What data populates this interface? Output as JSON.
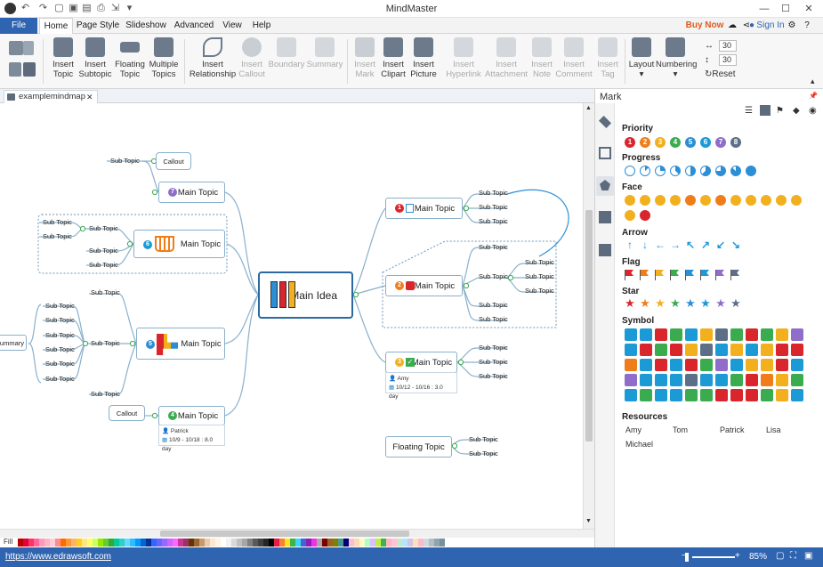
{
  "app": {
    "title": "MindMaster",
    "buy": "Buy Now",
    "signin": "Sign In"
  },
  "menu": {
    "file": "File",
    "home": "Home",
    "page_style": "Page Style",
    "slideshow": "Slideshow",
    "advanced": "Advanced",
    "view": "View",
    "help": "Help"
  },
  "ribbon": {
    "insert_topic": [
      "Insert",
      "Topic"
    ],
    "insert_subtopic": [
      "Insert",
      "Subtopic"
    ],
    "floating_topic": [
      "Floating",
      "Topic"
    ],
    "multiple_topics": [
      "Multiple",
      "Topics"
    ],
    "insert_relationship": [
      "Insert",
      "Relationship"
    ],
    "insert_callout": [
      "Insert",
      "Callout"
    ],
    "boundary": "Boundary",
    "summary": "Summary",
    "insert_mark": [
      "Insert",
      "Mark"
    ],
    "insert_clipart": [
      "Insert",
      "Clipart"
    ],
    "insert_picture": [
      "Insert",
      "Picture"
    ],
    "insert_hyperlink": [
      "Insert",
      "Hyperlink"
    ],
    "insert_attachment": [
      "Insert",
      "Attachment"
    ],
    "insert_note": [
      "Insert",
      "Note"
    ],
    "insert_comment": [
      "Insert",
      "Comment"
    ],
    "insert_tag": [
      "Insert",
      "Tag"
    ],
    "layout": "Layout",
    "numbering": "Numbering",
    "spacing_h": "30",
    "spacing_v": "30",
    "reset": "Reset"
  },
  "doc_tab": "examplemindmap",
  "map": {
    "main_idea": "Main Idea",
    "main_topic": "Main Topic",
    "sub_topic": "Sub Topic",
    "callout": "Callout",
    "summary": "Summary",
    "floating_topic": "Floating Topic",
    "amy": "Amy",
    "amy_date": "10/12 - 10/16 : 3.0 day",
    "patrick": "Patrick",
    "patrick_date": "10/9 - 10/18 : 8.0 day"
  },
  "panel": {
    "title": "Mark",
    "priority": "Priority",
    "priority_nums": [
      "1",
      "2",
      "3",
      "4",
      "5",
      "6",
      "7",
      "8"
    ],
    "priority_colors": [
      "#d9262c",
      "#f07d1a",
      "#f2b01e",
      "#3bab4f",
      "#2c8fd6",
      "#1c9ad6",
      "#8f6dc9",
      "#5c6f86"
    ],
    "progress": "Progress",
    "face": "Face",
    "arrow": "Arrow",
    "arrow_glyphs": [
      "↑",
      "↓",
      "←",
      "→",
      "↖",
      "↗",
      "↙",
      "↘"
    ],
    "flag": "Flag",
    "flag_colors": [
      "#d9262c",
      "#f07d1a",
      "#f2b01e",
      "#3bab4f",
      "#2c8fd6",
      "#1c9ad6",
      "#8f6dc9",
      "#5c6f86"
    ],
    "star": "Star",
    "star_colors": [
      "#d9262c",
      "#f07d1a",
      "#f2b01e",
      "#3bab4f",
      "#2c8fd6",
      "#1c9ad6",
      "#8f6dc9",
      "#5c6f86"
    ],
    "symbol": "Symbol",
    "resources": "Resources",
    "resource_names": [
      "Amy",
      "Tom",
      "Patrick",
      "Lisa",
      "Michael"
    ]
  },
  "status": {
    "url": "https://www.edrawsoft.com",
    "zoom": "85%",
    "fill": "Fill"
  }
}
